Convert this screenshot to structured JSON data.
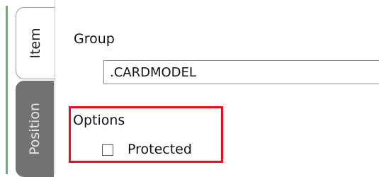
{
  "tabs": [
    {
      "label": "Item",
      "active": true
    },
    {
      "label": "Position",
      "active": false
    }
  ],
  "group": {
    "label": "Group",
    "value": ".CARDMODEL"
  },
  "options": {
    "label": "Options",
    "protected": {
      "label": "Protected",
      "checked": false
    }
  },
  "colors": {
    "highlight_border": "#e8101a",
    "inactive_tab": "#727272"
  }
}
